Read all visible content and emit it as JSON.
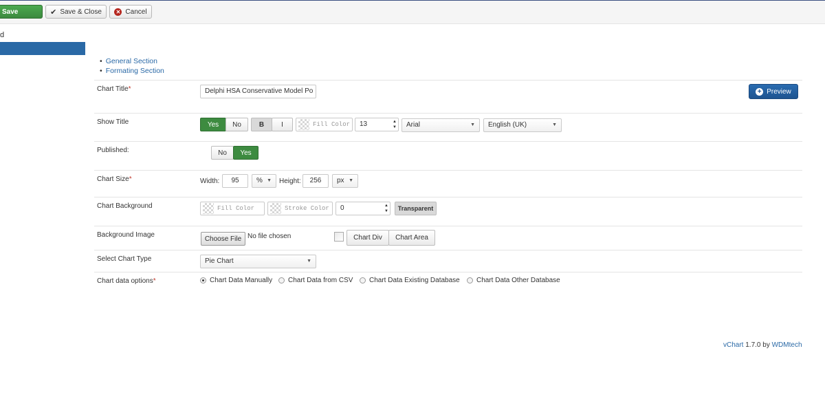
{
  "toolbar": {
    "save_label": "Save",
    "save_close_label": "Save & Close",
    "cancel_label": "Cancel"
  },
  "sidebar": {
    "partial_text": "d"
  },
  "section_links": [
    {
      "label": "General Section"
    },
    {
      "label": "Formating Section"
    }
  ],
  "form": {
    "chart_title": {
      "label": "Chart Title",
      "value": "Delphi HSA Conservative Model Po"
    },
    "preview_label": "Preview",
    "show_title": {
      "label": "Show Title",
      "yes": "Yes",
      "no": "No",
      "bold": "B",
      "italic": "I",
      "fill_color_placeholder": "Fill Color",
      "font_size": "13",
      "font": "Arial",
      "language": "English (UK)"
    },
    "published": {
      "label": "Published:",
      "no": "No",
      "yes": "Yes"
    },
    "chart_size": {
      "label": "Chart Size",
      "width_label": "Width:",
      "width_value": "95",
      "width_unit": "%",
      "height_label": "Height:",
      "height_value": "256",
      "height_unit": "px"
    },
    "chart_background": {
      "label": "Chart Background",
      "fill_color_placeholder": "Fill Color",
      "stroke_color_placeholder": "Stroke Color",
      "stroke_width": "0",
      "transparent_label": "Transparent"
    },
    "background_image": {
      "label": "Background Image",
      "choose_file": "Choose File",
      "no_file": "No file chosen",
      "chart_div": "Chart Div",
      "chart_area": "Chart Area"
    },
    "chart_type": {
      "label": "Select Chart Type",
      "value": "Pie Chart"
    },
    "data_options": {
      "label": "Chart data options",
      "options": [
        {
          "label": "Chart Data Manually",
          "selected": true
        },
        {
          "label": "Chart Data from CSV",
          "selected": false
        },
        {
          "label": "Chart Data Existing Database",
          "selected": false
        },
        {
          "label": "Chart Data Other Database",
          "selected": false
        }
      ]
    }
  },
  "footer": {
    "product": "vChart",
    "version": "1.7.0 by",
    "vendor": "WDMtech"
  },
  "colors": {
    "accent": "#2a69a6",
    "success": "#3d8b40",
    "danger": "#b5261e"
  }
}
